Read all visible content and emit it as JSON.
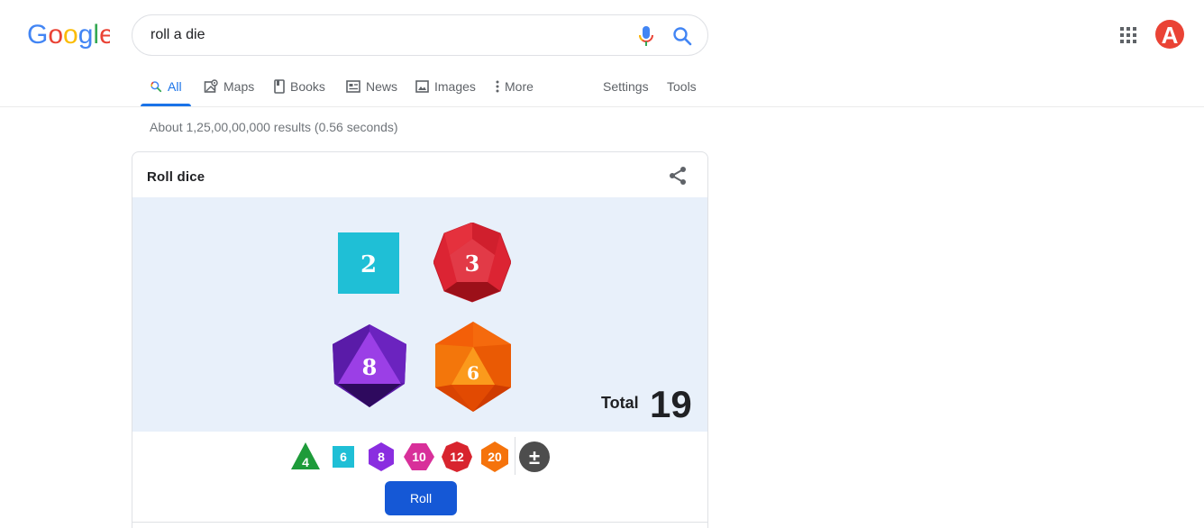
{
  "logo": {
    "letters": [
      "G",
      "o",
      "o",
      "g",
      "l",
      "e"
    ],
    "colors": [
      "#4285f4",
      "#ea4335",
      "#fbbc05",
      "#4285f4",
      "#34a853",
      "#ea4335"
    ]
  },
  "search": {
    "query": "roll a die"
  },
  "avatar": {
    "letter": "A",
    "color": "#ea4335"
  },
  "tabs": [
    {
      "label": "All",
      "icon": "search-icon",
      "active": true
    },
    {
      "label": "Maps",
      "icon": "map-icon"
    },
    {
      "label": "Books",
      "icon": "book-icon"
    },
    {
      "label": "News",
      "icon": "news-icon"
    },
    {
      "label": "Images",
      "icon": "image-icon"
    },
    {
      "label": "More",
      "icon": "more-vert-icon"
    }
  ],
  "tools": {
    "settings": "Settings",
    "tools": "Tools"
  },
  "result_stats": "About 1,25,00,00,000 results (0.56 seconds)",
  "card": {
    "title": "Roll dice",
    "dice": [
      {
        "type": "d6",
        "value": "2",
        "color": "#1fbfd6"
      },
      {
        "type": "d12",
        "value": "3",
        "color": "#dc2433"
      },
      {
        "type": "d8",
        "value": "8",
        "color": "#7d2ed0"
      },
      {
        "type": "d20",
        "value": "6",
        "color": "#f1630a"
      }
    ],
    "total_label": "Total",
    "total_value": "19",
    "picker": [
      {
        "label": "4",
        "type": "d4",
        "color": "#1e9b3a"
      },
      {
        "label": "6",
        "type": "d6",
        "color": "#1fbfd6"
      },
      {
        "label": "8",
        "type": "d8",
        "color": "#8a2ee0"
      },
      {
        "label": "10",
        "type": "d10",
        "color": "#d8309a"
      },
      {
        "label": "12",
        "type": "d12",
        "color": "#d8242e"
      },
      {
        "label": "20",
        "type": "d20",
        "color": "#f5730c"
      },
      {
        "label": "±",
        "type": "modifier",
        "color": "#4d4d4d"
      }
    ],
    "roll_label": "Roll"
  }
}
